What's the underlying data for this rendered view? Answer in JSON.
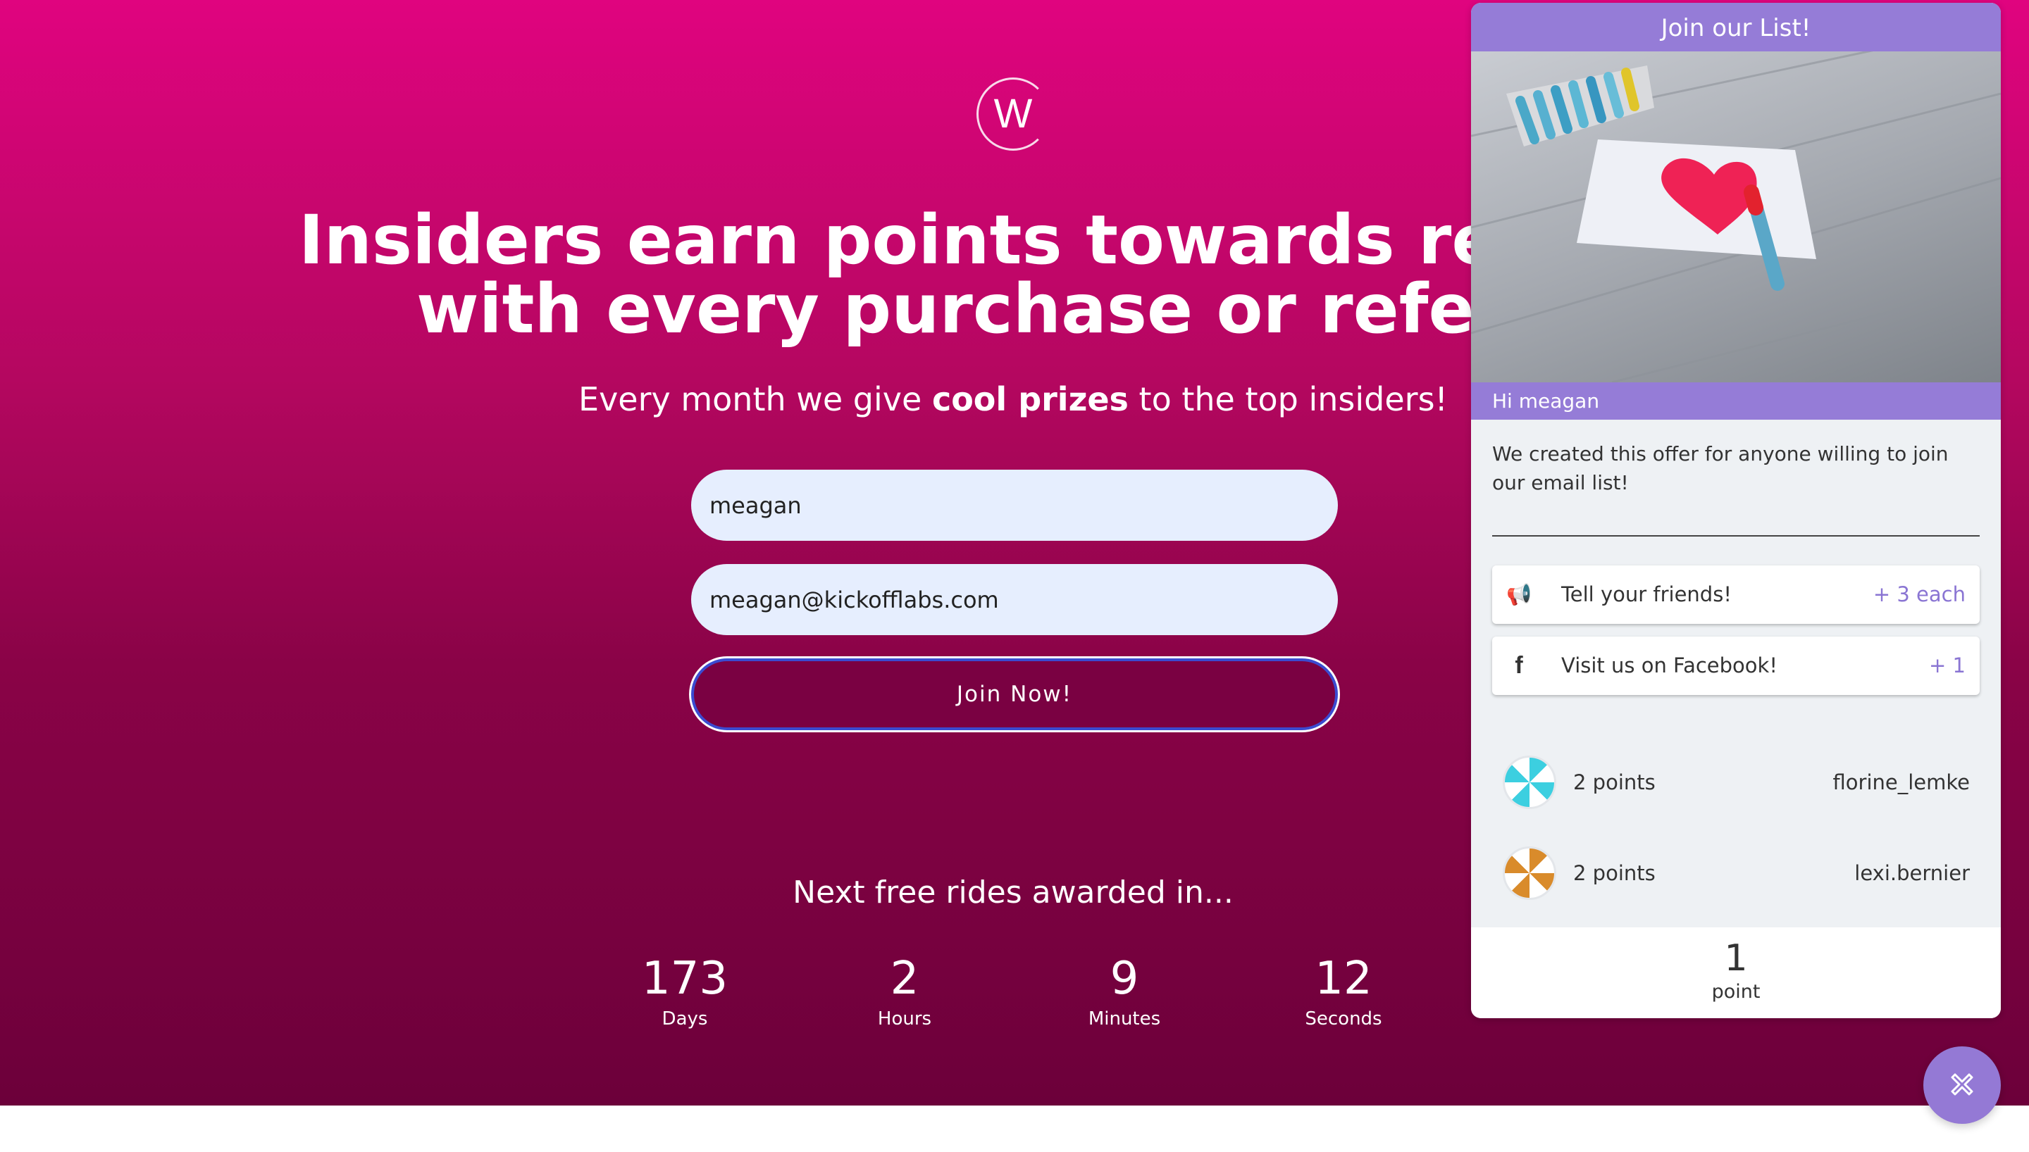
{
  "hero": {
    "logo_letter": "W",
    "headline_line1": "Insiders earn points towards rewards",
    "headline_line2": "with every purchase or referral",
    "sub_pre": "Every month we give ",
    "sub_bold": "cool prizes",
    "sub_post": " to the top insiders!",
    "name_value": "meagan",
    "email_value": "meagan@kickofflabs.com",
    "join_label": "Join Now!",
    "countdown_title": "Next free rides awarded in...",
    "countdown": [
      {
        "value": "173",
        "label": "Days"
      },
      {
        "value": "2",
        "label": "Hours"
      },
      {
        "value": "9",
        "label": "Minutes"
      },
      {
        "value": "12",
        "label": "Seconds"
      }
    ]
  },
  "panel": {
    "title": "Join our List!",
    "greeting": "Hi meagan",
    "description": "We created this offer for anyone willing to join our email list!",
    "actions": [
      {
        "icon": "megaphone-icon",
        "label": "Tell your friends!",
        "points": "+ 3 each"
      },
      {
        "icon": "facebook-icon",
        "label": "Visit us on Facebook!",
        "points": "+ 1"
      }
    ],
    "leaderboard": [
      {
        "points": "2 points",
        "name": "florine_lemke",
        "color": "#3ccfe0"
      },
      {
        "points": "2 points",
        "name": "lexi.bernier",
        "color": "#d98b2b"
      }
    ],
    "my_points": "1",
    "my_points_label": "point"
  },
  "colors": {
    "accent": "#957cd7",
    "hero_top": "#e0047f",
    "hero_bottom": "#6c003a"
  }
}
